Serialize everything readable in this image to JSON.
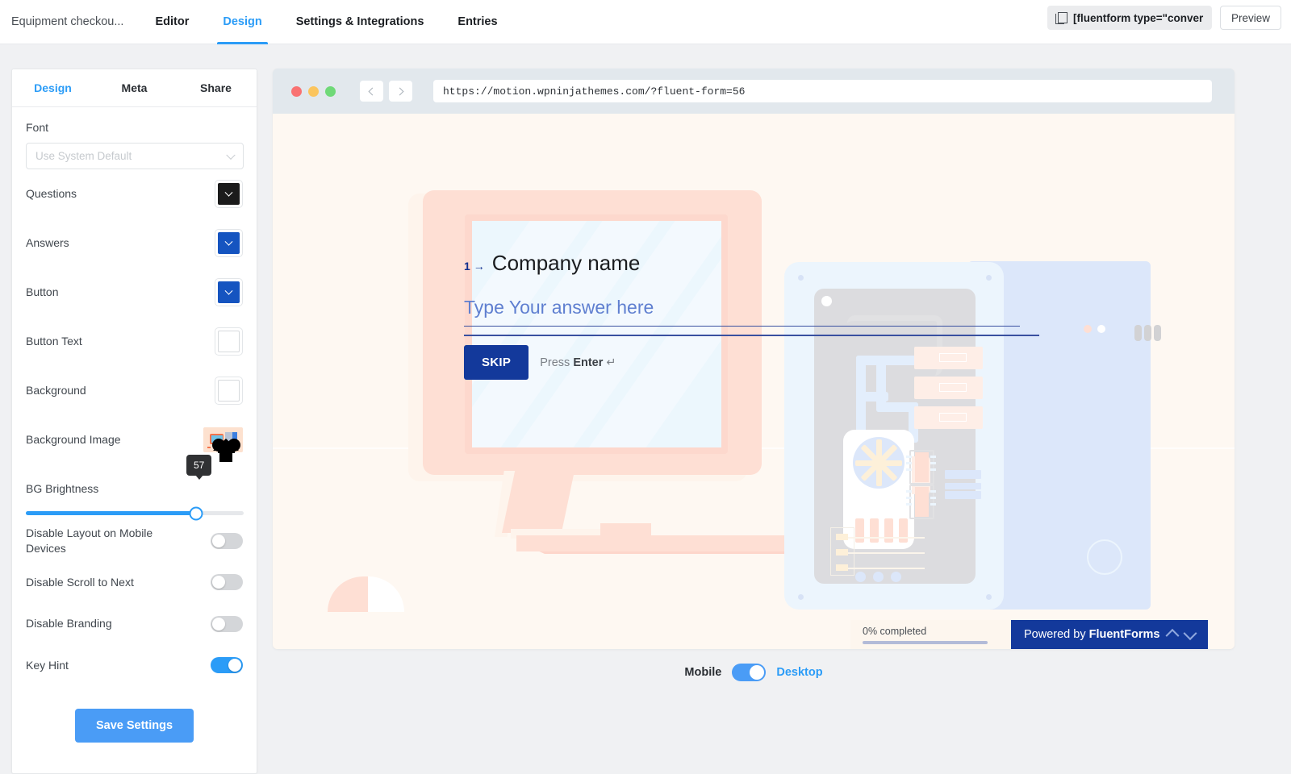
{
  "topbar": {
    "form_title": "Equipment checkou...",
    "nav": [
      {
        "label": "Editor",
        "active": false
      },
      {
        "label": "Design",
        "active": true
      },
      {
        "label": "Settings & Integrations",
        "active": false
      },
      {
        "label": "Entries",
        "active": false
      }
    ],
    "shortcode": "[fluentform type=\"conver",
    "shortcode_icon": "copy-icon",
    "preview_label": "Preview"
  },
  "sidebar": {
    "tabs": [
      {
        "label": "Design",
        "active": true
      },
      {
        "label": "Meta",
        "active": false
      },
      {
        "label": "Share",
        "active": false
      }
    ],
    "font": {
      "label": "Font",
      "placeholder": "Use System Default",
      "value": ""
    },
    "colors": [
      {
        "label": "Questions",
        "value": "#1b1b1b"
      },
      {
        "label": "Answers",
        "value": "#1554c0"
      },
      {
        "label": "Button",
        "value": "#1554c0"
      },
      {
        "label": "Button Text",
        "value": "#ffffff"
      },
      {
        "label": "Background",
        "value": "#ffffff"
      }
    ],
    "background_image": {
      "label": "Background Image"
    },
    "brightness": {
      "label": "BG Brightness",
      "value": "57",
      "percent": 78
    },
    "toggles": [
      {
        "label": "Disable Layout on Mobile Devices",
        "on": false
      },
      {
        "label": "Disable Scroll to Next",
        "on": false
      },
      {
        "label": "Disable Branding",
        "on": false
      },
      {
        "label": "Key Hint",
        "on": true
      }
    ],
    "save_label": "Save Settings"
  },
  "preview": {
    "url": "https://motion.wpninjathemes.com/?fluent-form=56",
    "form": {
      "question_number": "1",
      "question_arrow": "→",
      "question": "Company name",
      "answer_placeholder": "Type Your answer here",
      "skip_label": "SKIP",
      "hint_prefix": "Press ",
      "hint_key": "Enter",
      "hint_symbol": "↵"
    },
    "footer": {
      "progress_label": "0% completed",
      "progress_percent": 0,
      "powered_prefix": "Powered by ",
      "powered_brand": "FluentForms"
    }
  },
  "device_toggle": {
    "left_label": "Mobile",
    "right_label": "Desktop",
    "selected": "Desktop"
  },
  "theme": {
    "accent_blue": "#2b9cf7",
    "brand_blue": "#13399b",
    "canvas_bg": "#fdeede"
  }
}
